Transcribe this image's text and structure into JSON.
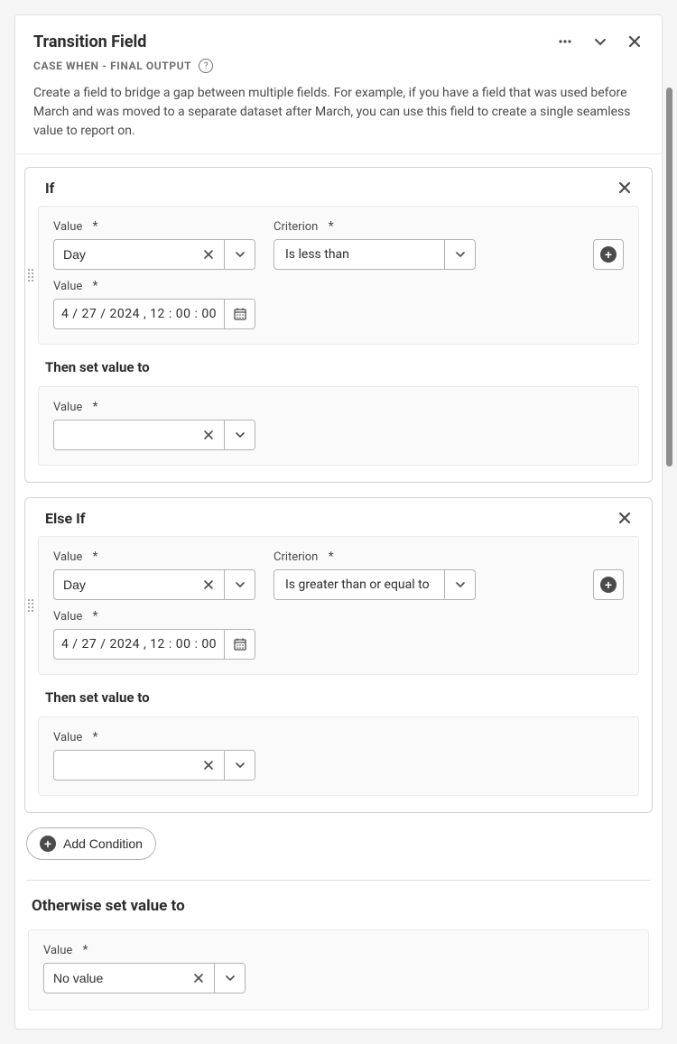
{
  "header": {
    "title": "Transition Field",
    "subtitle": "CASE WHEN - FINAL OUTPUT",
    "description": "Create a field to bridge a gap between multiple fields. For example, if you have a field that was used before March and was moved to a separate dataset after March, you can use this field to create a single seamless value to report on."
  },
  "labels": {
    "value": "Value",
    "criterion": "Criterion",
    "then_set_value_to": "Then set value to",
    "add_condition": "Add Condition",
    "otherwise_set_value_to": "Otherwise set value to"
  },
  "conditions": [
    {
      "title": "If",
      "value1": "Day",
      "criterion": "Is less than",
      "value2": "4 / 27 / 2024 ,   12 : 00 : 00",
      "then_value": ""
    },
    {
      "title": "Else If",
      "value1": "Day",
      "criterion": "Is greater than or equal to",
      "value2": "4 / 27 / 2024 ,   12 : 00 : 00",
      "then_value": ""
    }
  ],
  "otherwise": {
    "value": "No value"
  }
}
